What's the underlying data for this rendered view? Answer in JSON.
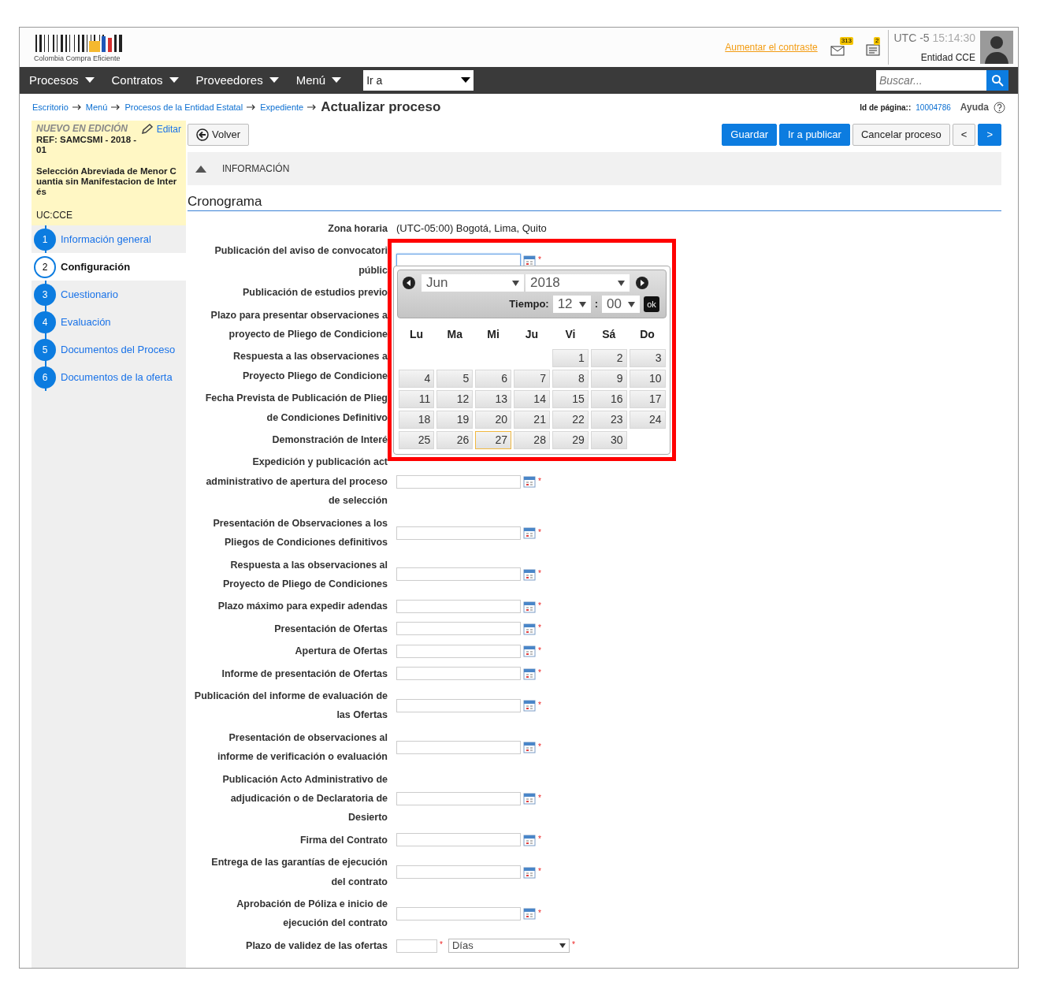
{
  "header": {
    "logo_text": "Colombia Compra Eficiente",
    "contrast_link": "Aumentar el contraste",
    "mail_count": "313",
    "notes_count": "2",
    "timezone": "UTC -5",
    "clock": "15:14:30",
    "entity": "Entidad CCE"
  },
  "nav": {
    "menus": [
      "Procesos",
      "Contratos",
      "Proveedores",
      "Menú"
    ],
    "goto": "Ir a",
    "search_placeholder": "Buscar..."
  },
  "breadcrumb": {
    "links": [
      "Escritorio",
      "Menú",
      "Procesos de la Entidad Estatal",
      "Expediente"
    ],
    "current": "Actualizar proceso",
    "page_id_label": "Id de página::",
    "page_id": "10004786",
    "help": "Ayuda"
  },
  "process": {
    "status": "NUEVO EN EDICIÓN",
    "edit": "Editar",
    "ref": "REF: SAMCSMI - 2018 - 01",
    "description": "Selección Abreviada de Menor Cuantia sin Manifestacion de Interés",
    "unit": "UC:CCE"
  },
  "steps": [
    {
      "number": "1",
      "label": "Información general",
      "selected": false
    },
    {
      "number": "2",
      "label": "Configuración",
      "selected": true
    },
    {
      "number": "3",
      "label": "Cuestionario",
      "selected": false
    },
    {
      "number": "4",
      "label": "Evaluación",
      "selected": false
    },
    {
      "number": "5",
      "label": "Documentos del Proceso",
      "selected": false
    },
    {
      "number": "6",
      "label": "Documentos de la oferta",
      "selected": false
    }
  ],
  "toolbar": {
    "back": "Volver",
    "buttons": [
      {
        "label": "Guardar",
        "kind": "primary"
      },
      {
        "label": "Ir a publicar",
        "kind": "primary"
      },
      {
        "label": "Cancelar proceso",
        "kind": "default"
      },
      {
        "label": "<",
        "kind": "default"
      },
      {
        "label": ">",
        "kind": "primary"
      }
    ]
  },
  "section": {
    "title": "INFORMACIÓN",
    "expanded": true
  },
  "schedule": {
    "title": "Cronograma",
    "timezone_label": "Zona horaria",
    "timezone_value": "(UTC-05:00) Bogotá, Lima, Quito",
    "rows": [
      {
        "label_lines": [
          "Publicación del aviso de convocatori",
          "públic"
        ],
        "kind": "date",
        "required_mark": "*",
        "focused": true
      },
      {
        "label_lines": [
          "Publicación de estudios previo"
        ],
        "kind": "label"
      },
      {
        "label_lines": [
          "Plazo para presentar observaciones a",
          "proyecto de Pliego de Condicione"
        ],
        "kind": "label"
      },
      {
        "label_lines": [
          "Respuesta a las observaciones a",
          "Proyecto Pliego de Condicione"
        ],
        "kind": "label"
      },
      {
        "label_lines": [
          "Fecha Prevista de Publicación de Plieg",
          "de Condiciones Definitivo"
        ],
        "kind": "label"
      },
      {
        "label_lines": [
          "Demonstración de Interé"
        ],
        "kind": "label"
      },
      {
        "label_lines": [
          "Expedición y publicación act",
          "administrativo de apertura del proceso",
          "de selección"
        ],
        "kind": "date",
        "required_mark": "*",
        "focused": false
      },
      {
        "label_lines": [
          "Presentación de Observaciones a los",
          "Pliegos de Condiciones definitivos"
        ],
        "kind": "date",
        "required_mark": "*",
        "focused": false
      },
      {
        "label_lines": [
          "Respuesta a las observaciones al",
          "Proyecto de Pliego de Condiciones"
        ],
        "kind": "date",
        "required_mark": "*",
        "focused": false
      },
      {
        "label_lines": [
          "Plazo máximo para expedir adendas"
        ],
        "kind": "date",
        "required_mark": "*",
        "focused": false
      },
      {
        "label_lines": [
          "Presentación de Ofertas"
        ],
        "kind": "date",
        "required_mark": "*",
        "focused": false
      },
      {
        "label_lines": [
          "Apertura de Ofertas"
        ],
        "kind": "date",
        "required_mark": "*",
        "focused": false
      },
      {
        "label_lines": [
          "Informe de presentación de Ofertas"
        ],
        "kind": "date",
        "required_mark": "*",
        "focused": false
      },
      {
        "label_lines": [
          "Publicación del informe de evaluación de",
          "las Ofertas"
        ],
        "kind": "date",
        "required_mark": "*",
        "focused": false
      },
      {
        "label_lines": [
          "Presentación de observaciones al",
          "informe de verificación o evaluación"
        ],
        "kind": "date",
        "required_mark": "*",
        "focused": false
      },
      {
        "label_lines": [
          "Publicación Acto Administrativo de",
          "adjudicación o de Declaratoria de",
          "Desierto"
        ],
        "kind": "date",
        "required_mark": "*",
        "focused": false
      },
      {
        "label_lines": [
          "Firma del Contrato"
        ],
        "kind": "date",
        "required_mark": "*",
        "focused": false
      },
      {
        "label_lines": [
          "Entrega de las garantías de ejecución",
          "del contrato"
        ],
        "kind": "date",
        "required_mark": "*",
        "focused": false
      },
      {
        "label_lines": [
          "Aprobación de Póliza e inicio de",
          "ejecución del contrato"
        ],
        "kind": "date",
        "required_mark": "*",
        "focused": false
      },
      {
        "label_lines": [
          "Plazo de validez de las ofertas"
        ],
        "kind": "days",
        "required_mark": "*",
        "unit": "Días",
        "unit_required_mark": "*",
        "focused": false
      }
    ]
  },
  "datepicker": {
    "highlighted": true,
    "month": "Jun",
    "year": "2018",
    "time_label": "Tiempo:",
    "hour": "12",
    "separator": ":",
    "minute": "00",
    "ok": "ok",
    "weekdays": [
      "Lu",
      "Ma",
      "Mi",
      "Ju",
      "Vi",
      "Sá",
      "Do"
    ],
    "weeks": [
      [
        {
          "kind": "blank"
        },
        {
          "kind": "blank"
        },
        {
          "kind": "blank"
        },
        {
          "kind": "blank"
        },
        {
          "kind": "day",
          "day": "1",
          "today": false
        },
        {
          "kind": "day",
          "day": "2",
          "today": false
        },
        {
          "kind": "day",
          "day": "3",
          "today": false
        }
      ],
      [
        {
          "kind": "day",
          "day": "4",
          "today": false
        },
        {
          "kind": "day",
          "day": "5",
          "today": false
        },
        {
          "kind": "day",
          "day": "6",
          "today": false
        },
        {
          "kind": "day",
          "day": "7",
          "today": false
        },
        {
          "kind": "day",
          "day": "8",
          "today": false
        },
        {
          "kind": "day",
          "day": "9",
          "today": false
        },
        {
          "kind": "day",
          "day": "10",
          "today": false
        }
      ],
      [
        {
          "kind": "day",
          "day": "11",
          "today": false
        },
        {
          "kind": "day",
          "day": "12",
          "today": false
        },
        {
          "kind": "day",
          "day": "13",
          "today": false
        },
        {
          "kind": "day",
          "day": "14",
          "today": false
        },
        {
          "kind": "day",
          "day": "15",
          "today": false
        },
        {
          "kind": "day",
          "day": "16",
          "today": false
        },
        {
          "kind": "day",
          "day": "17",
          "today": false
        }
      ],
      [
        {
          "kind": "day",
          "day": "18",
          "today": false
        },
        {
          "kind": "day",
          "day": "19",
          "today": false
        },
        {
          "kind": "day",
          "day": "20",
          "today": false
        },
        {
          "kind": "day",
          "day": "21",
          "today": false
        },
        {
          "kind": "day",
          "day": "22",
          "today": false
        },
        {
          "kind": "day",
          "day": "23",
          "today": false
        },
        {
          "kind": "day",
          "day": "24",
          "today": false
        }
      ],
      [
        {
          "kind": "day",
          "day": "25",
          "today": false
        },
        {
          "kind": "day",
          "day": "26",
          "today": false
        },
        {
          "kind": "day",
          "day": "27",
          "today": true
        },
        {
          "kind": "day",
          "day": "28",
          "today": false
        },
        {
          "kind": "day",
          "day": "29",
          "today": false
        },
        {
          "kind": "day",
          "day": "30",
          "today": false
        },
        {
          "kind": "blank"
        }
      ]
    ]
  }
}
